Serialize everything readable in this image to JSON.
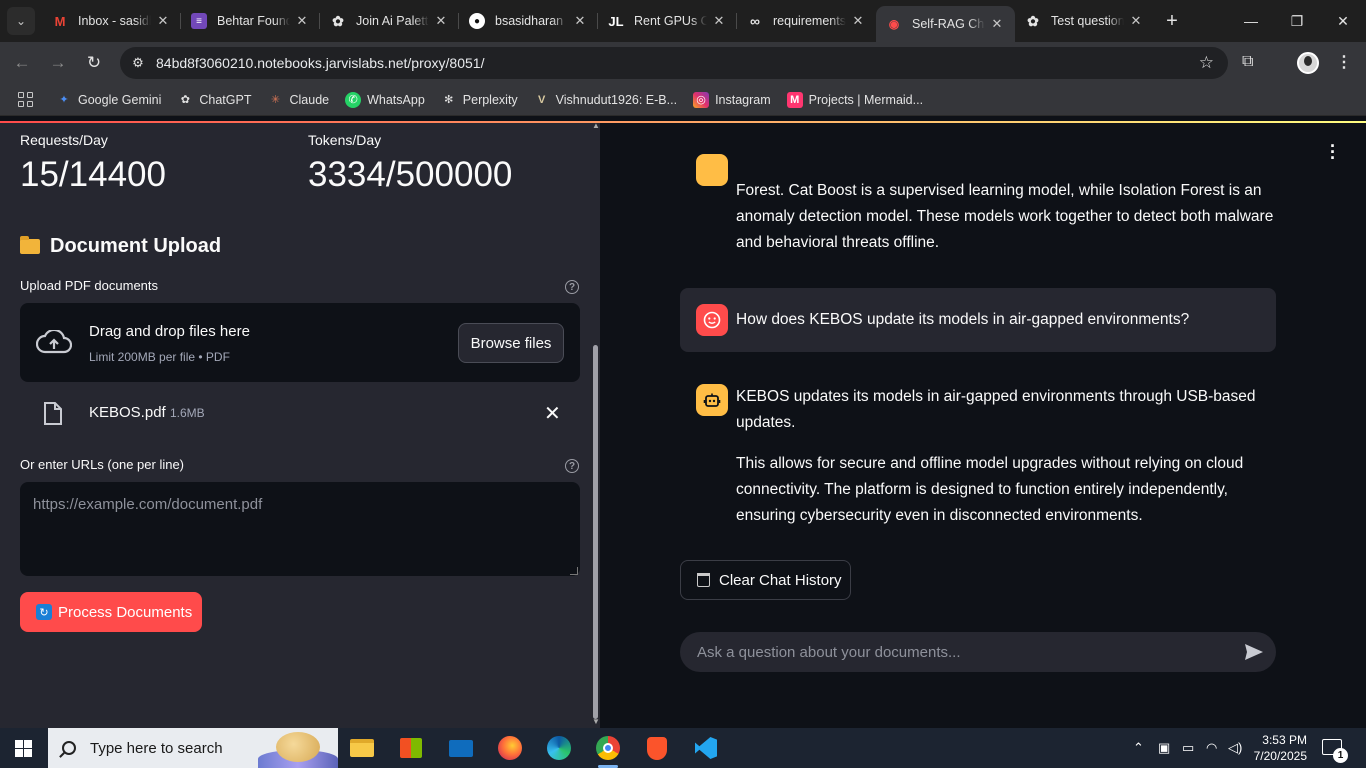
{
  "browser": {
    "tabs": [
      {
        "title": "Inbox - sasidharan",
        "icon": "gmail-icon",
        "color": "#ea4335"
      },
      {
        "title": "Behtar Foundation",
        "icon": "form-icon",
        "color": "#7248b9"
      },
      {
        "title": "Join Ai Palette",
        "icon": "openai-icon",
        "color": "#e3e3e3"
      },
      {
        "title": "bsasidharan",
        "icon": "github-icon",
        "color": "#ffffff"
      },
      {
        "title": "Rent GPUs Online",
        "icon": "jarvislabs-icon",
        "color": "#ffffff"
      },
      {
        "title": "requirements",
        "icon": "link-icon",
        "color": "#e3e3e3"
      },
      {
        "title": "Self-RAG Chat",
        "icon": "streamlit-icon",
        "color": "#ff4b4b",
        "active": true
      },
      {
        "title": "Test questions",
        "icon": "openai-icon",
        "color": "#e3e3e3"
      }
    ],
    "url": "84bd8f3060210.notebooks.jarvislabs.net/proxy/8051/",
    "bookmarks": [
      {
        "label": "Google Gemini",
        "icon": "gemini-icon",
        "color": "#4b8ef5"
      },
      {
        "label": "ChatGPT",
        "icon": "openai-icon",
        "color": "#e3e3e3"
      },
      {
        "label": "Claude",
        "icon": "claude-icon",
        "color": "#d97757"
      },
      {
        "label": "WhatsApp",
        "icon": "whatsapp-icon",
        "color": "#25d366"
      },
      {
        "label": "Perplexity",
        "icon": "perplexity-icon",
        "color": "#e3e3e3"
      },
      {
        "label": "Vishnudut1926: E-B...",
        "icon": "v-icon",
        "color": "#d8c9a0"
      },
      {
        "label": "Instagram",
        "icon": "instagram-icon",
        "color": "#e1306c"
      },
      {
        "label": "Projects | Mermaid...",
        "icon": "mermaid-icon",
        "color": "#ff3670"
      }
    ]
  },
  "sidebar": {
    "metrics": [
      {
        "label": "Requests/Day",
        "value": "15/14400"
      },
      {
        "label": "Tokens/Day",
        "value": "3334/500000"
      }
    ],
    "upload_header": "Document Upload",
    "upload_label": "Upload PDF documents",
    "dropzone_title": "Drag and drop files here",
    "dropzone_sub": "Limit 200MB per file • PDF",
    "browse_label": "Browse files",
    "file": {
      "name": "KEBOS.pdf",
      "size": "1.6MB"
    },
    "urls_label": "Or enter URLs (one per line)",
    "urls_placeholder": "https://example.com/document.pdf",
    "process_label": "Process Documents"
  },
  "chat": {
    "messages": [
      {
        "role": "assistant",
        "text": "Forest. Cat Boost is a supervised learning model, while Isolation Forest is an anomaly detection model. These models work together to detect both malware and behavioral threats offline."
      },
      {
        "role": "user",
        "text": "How does KEBOS update its models in air-gapped environments?"
      },
      {
        "role": "assistant",
        "text": "KEBOS updates its models in air-gapped environments through USB-based updates.",
        "text2": "This allows for secure and offline model upgrades without relying on cloud connectivity. The platform is designed to function entirely independently, ensuring cybersecurity even in disconnected environments."
      }
    ],
    "clear_label": "Clear Chat History",
    "input_placeholder": "Ask a question about your documents..."
  },
  "taskbar": {
    "search_placeholder": "Type here to search",
    "apps": [
      "file-explorer-icon",
      "store-icon",
      "mail-icon",
      "firefox-icon",
      "edge-icon",
      "chrome-icon",
      "brave-icon",
      "vscode-icon"
    ],
    "time": "3:53 PM",
    "date": "7/20/2025",
    "notifications": "1"
  },
  "colors": {
    "accent": "#ff4b4b",
    "sidebar_bg": "#262730",
    "main_bg": "#0e1117",
    "bot_avatar": "#ffbd45"
  }
}
